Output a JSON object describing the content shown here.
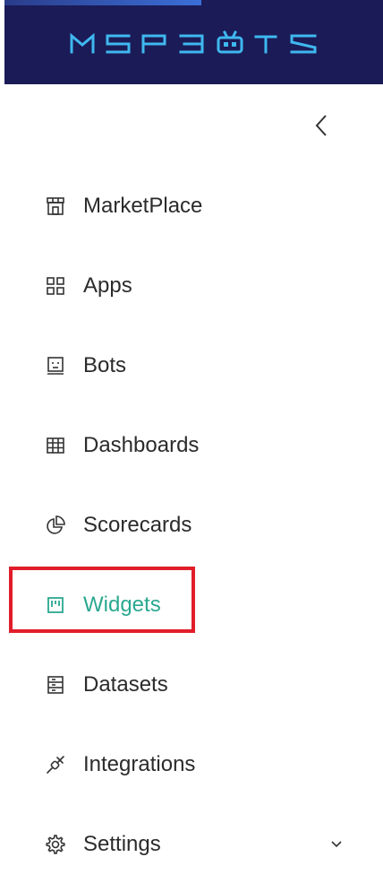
{
  "brand": {
    "logo_text": "MSPBOTS",
    "header_bg": "#1b1b57",
    "logo_color": "#3fb8ef"
  },
  "sidebar": {
    "collapse_icon": "chevron-left-icon",
    "items": [
      {
        "label": "MarketPlace",
        "icon": "store-icon",
        "active": false
      },
      {
        "label": "Apps",
        "icon": "apps-grid-icon",
        "active": false
      },
      {
        "label": "Bots",
        "icon": "bot-face-icon",
        "active": false
      },
      {
        "label": "Dashboards",
        "icon": "table-grid-icon",
        "active": false
      },
      {
        "label": "Scorecards",
        "icon": "pie-chart-icon",
        "active": false
      },
      {
        "label": "Widgets",
        "icon": "widget-icon",
        "active": true
      },
      {
        "label": "Datasets",
        "icon": "dataset-icon",
        "active": false
      },
      {
        "label": "Integrations",
        "icon": "plug-icon",
        "active": false
      },
      {
        "label": "Settings",
        "icon": "gear-icon",
        "active": false,
        "has_submenu": true,
        "submenu_icon": "chevron-down-icon"
      }
    ]
  },
  "colors": {
    "active": "#2aa890",
    "text": "#2b2b2b",
    "icon": "#333333",
    "highlight": "#e11d2a"
  }
}
